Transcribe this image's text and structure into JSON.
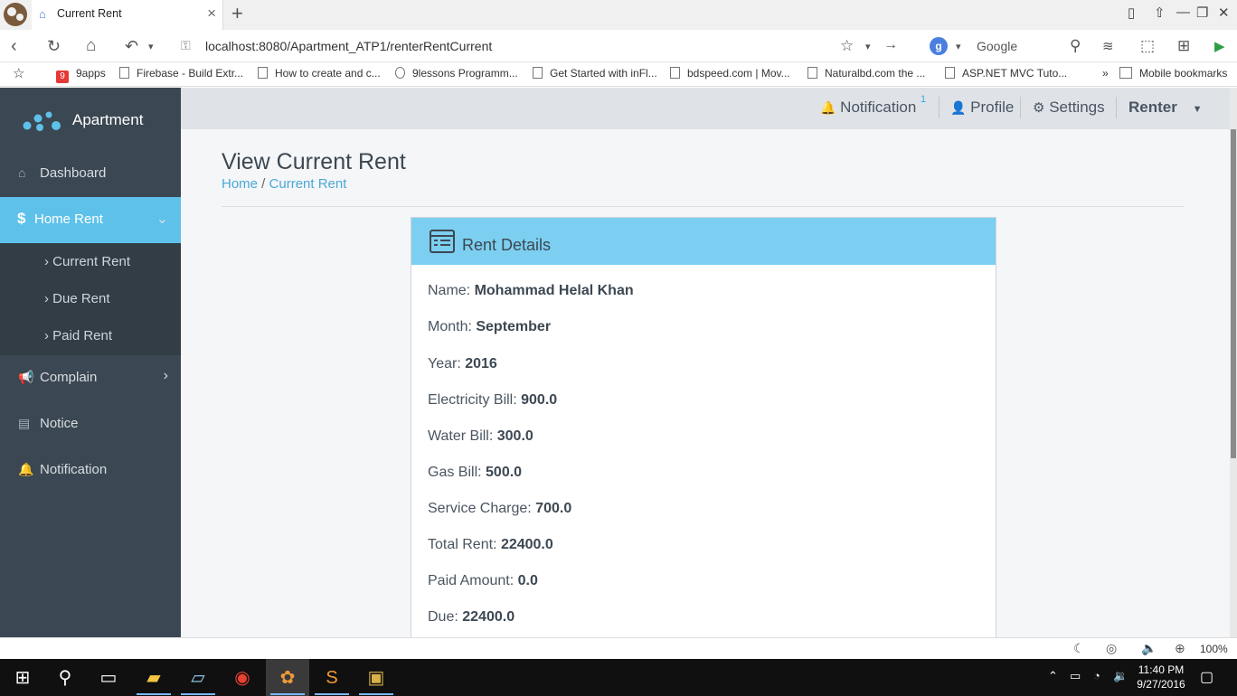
{
  "browser": {
    "tab_title": "Current Rent",
    "url": "localhost:8080/Apartment_ATP1/renterRentCurrent",
    "search_engine": "Google",
    "zoom": "100%",
    "bookmarks": [
      "9apps",
      "Firebase - Build Extr...",
      "How to create and c...",
      "9lessons Programm...",
      "Get Started with inFl...",
      "bdspeed.com | Mov...",
      "Naturalbd.com the ...",
      "ASP.NET MVC Tuto...",
      "Mobile bookmarks"
    ],
    "more_bookmarks": "»"
  },
  "sidebar": {
    "brand": "Apartment",
    "items": [
      {
        "label": "Dashboard",
        "icon": "dashboard-icon"
      },
      {
        "label": "Home Rent",
        "icon": "dollar-icon"
      },
      {
        "label": "Complain",
        "icon": "megaphone-icon"
      },
      {
        "label": "Notice",
        "icon": "document-icon"
      },
      {
        "label": "Notification",
        "icon": "bell-icon"
      }
    ],
    "submenu": [
      "› Current Rent",
      "› Due Rent",
      "› Paid Rent"
    ]
  },
  "header": {
    "notification": "Notification",
    "notification_count": "1",
    "profile": "Profile",
    "settings": "Settings",
    "user": "Renter"
  },
  "page": {
    "title": "View Current Rent",
    "breadcrumb": {
      "home": "Home",
      "separator": " / ",
      "current": "Current Rent"
    }
  },
  "panel": {
    "title": "Rent Details",
    "rows": [
      {
        "label": "Name: ",
        "value": "Mohammad Helal Khan"
      },
      {
        "label": "Month: ",
        "value": "September"
      },
      {
        "label": "Year: ",
        "value": "2016"
      },
      {
        "label": "Electricity Bill: ",
        "value": "900.0"
      },
      {
        "label": "Water Bill: ",
        "value": "300.0"
      },
      {
        "label": "Gas Bill: ",
        "value": "500.0"
      },
      {
        "label": "Service Charge: ",
        "value": "700.0"
      },
      {
        "label": "Total Rent: ",
        "value": "22400.0"
      },
      {
        "label": "Paid Amount: ",
        "value": "0.0"
      },
      {
        "label": "Due: ",
        "value": "22400.0"
      }
    ]
  },
  "taskbar": {
    "time": "11:40 PM",
    "date": "9/27/2016"
  },
  "colors": {
    "sidebar_bg": "#3b4752",
    "accent": "#5ec1ea",
    "panel_header": "#7ccff1",
    "link": "#4aa8d8"
  }
}
